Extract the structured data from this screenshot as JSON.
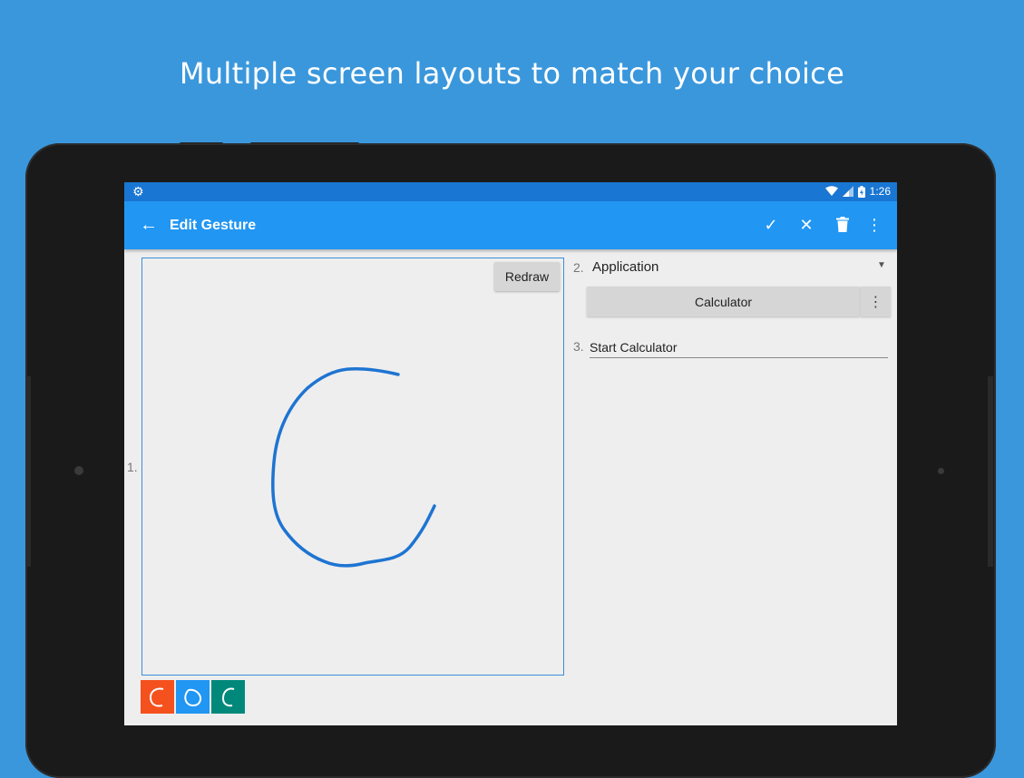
{
  "headline": "Multiple screen layouts to match your choice",
  "statusbar": {
    "time": "1:26",
    "icons": [
      "settings-gear-icon",
      "wifi-icon",
      "signal-icon",
      "battery-charging-icon"
    ]
  },
  "appbar": {
    "title": "Edit Gesture",
    "back_icon": "arrow-back-icon",
    "actions": [
      "check-icon",
      "close-icon",
      "delete-icon",
      "more-vert-icon"
    ]
  },
  "step1": {
    "number": "1.",
    "redraw_label": "Redraw"
  },
  "step2": {
    "number": "2.",
    "action_type": "Application",
    "app_name": "Calculator"
  },
  "step3": {
    "number": "3.",
    "gesture_name": "Start Calculator"
  },
  "thumbnails": [
    {
      "color": "#f4511e",
      "shape": "c-open"
    },
    {
      "color": "#2196f3",
      "shape": "loop"
    },
    {
      "color": "#00897b",
      "shape": "c-open"
    }
  ],
  "colors": {
    "background": "#3a97dc",
    "status_bar": "#1976d2",
    "app_bar": "#2196f3",
    "stroke": "#1e74d2"
  }
}
